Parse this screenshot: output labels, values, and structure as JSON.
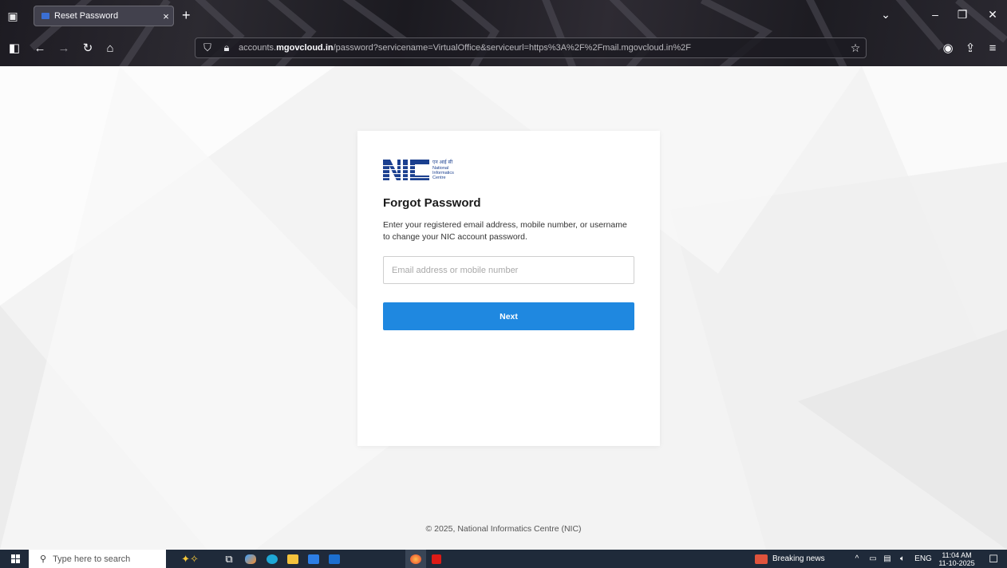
{
  "browser": {
    "tab_title": "Reset Password",
    "tab_close": "×",
    "new_tab": "+",
    "tab_list": "⌄",
    "window_controls": {
      "list": "⌄",
      "minimize": "–",
      "restore": "❐",
      "close": "✕"
    },
    "url_domain_prefix": "accounts.",
    "url_domain_main": "mgovcloud.in",
    "url_path": "/password?servicename=VirtualOffice&serviceurl=https%3A%2F%2Fmail.mgovcloud.in%2F",
    "icons": {
      "sidebar": "sidebar-icon",
      "back": "back-arrow-icon",
      "forward": "forward-arrow-icon",
      "reload": "reload-icon",
      "home": "home-icon",
      "shield": "shield-icon",
      "lock": "lock-icon",
      "bookmark": "star-icon",
      "account": "account-icon",
      "extensions": "extensions-icon",
      "menu": "menu-icon"
    }
  },
  "page": {
    "logo": {
      "hindi": "एन आई सी",
      "line1": "National",
      "line2": "Informatics",
      "line3": "Centre",
      "brand_color": "#1a3f8f"
    },
    "title": "Forgot Password",
    "description": "Enter your registered email address, mobile number, or username to change your NIC account password.",
    "input": {
      "placeholder": "Email address or mobile number",
      "value": ""
    },
    "next_button": "Next",
    "footer": "© 2025, National Informatics Centre (NIC)",
    "accent": "#1f88e0"
  },
  "taskbar": {
    "search_placeholder": "Type here to search",
    "news": "Breaking news",
    "language": "ENG",
    "time": "11:04 AM",
    "date": "11-10-2025"
  }
}
